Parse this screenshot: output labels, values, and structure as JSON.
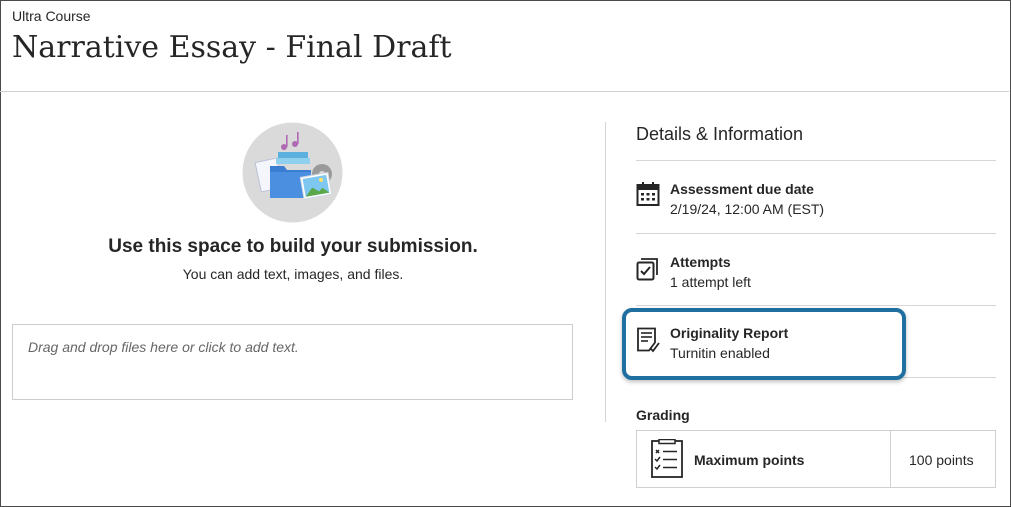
{
  "header": {
    "breadcrumb": "Ultra Course",
    "title": "Narrative Essay - Final Draft"
  },
  "submission": {
    "heading": "Use this space to build your submission.",
    "subheading": "You can add text, images, and files.",
    "dropzone_placeholder": "Drag and drop files here or click to add text."
  },
  "details": {
    "title": "Details & Information",
    "due": {
      "label": "Assessment due date",
      "value": "2/19/24, 12:00 AM (EST)",
      "icon": "calendar-icon"
    },
    "attempts": {
      "label": "Attempts",
      "value": "1 attempt left",
      "icon": "attempts-icon"
    },
    "originality": {
      "label": "Originality Report",
      "value": "Turnitin enabled",
      "icon": "report-icon"
    }
  },
  "grading": {
    "title": "Grading",
    "max_points_label": "Maximum points",
    "max_points_value": "100 points",
    "icon": "rubric-list-icon"
  },
  "colors": {
    "highlight": "#1f6fa0",
    "text": "#262626"
  }
}
